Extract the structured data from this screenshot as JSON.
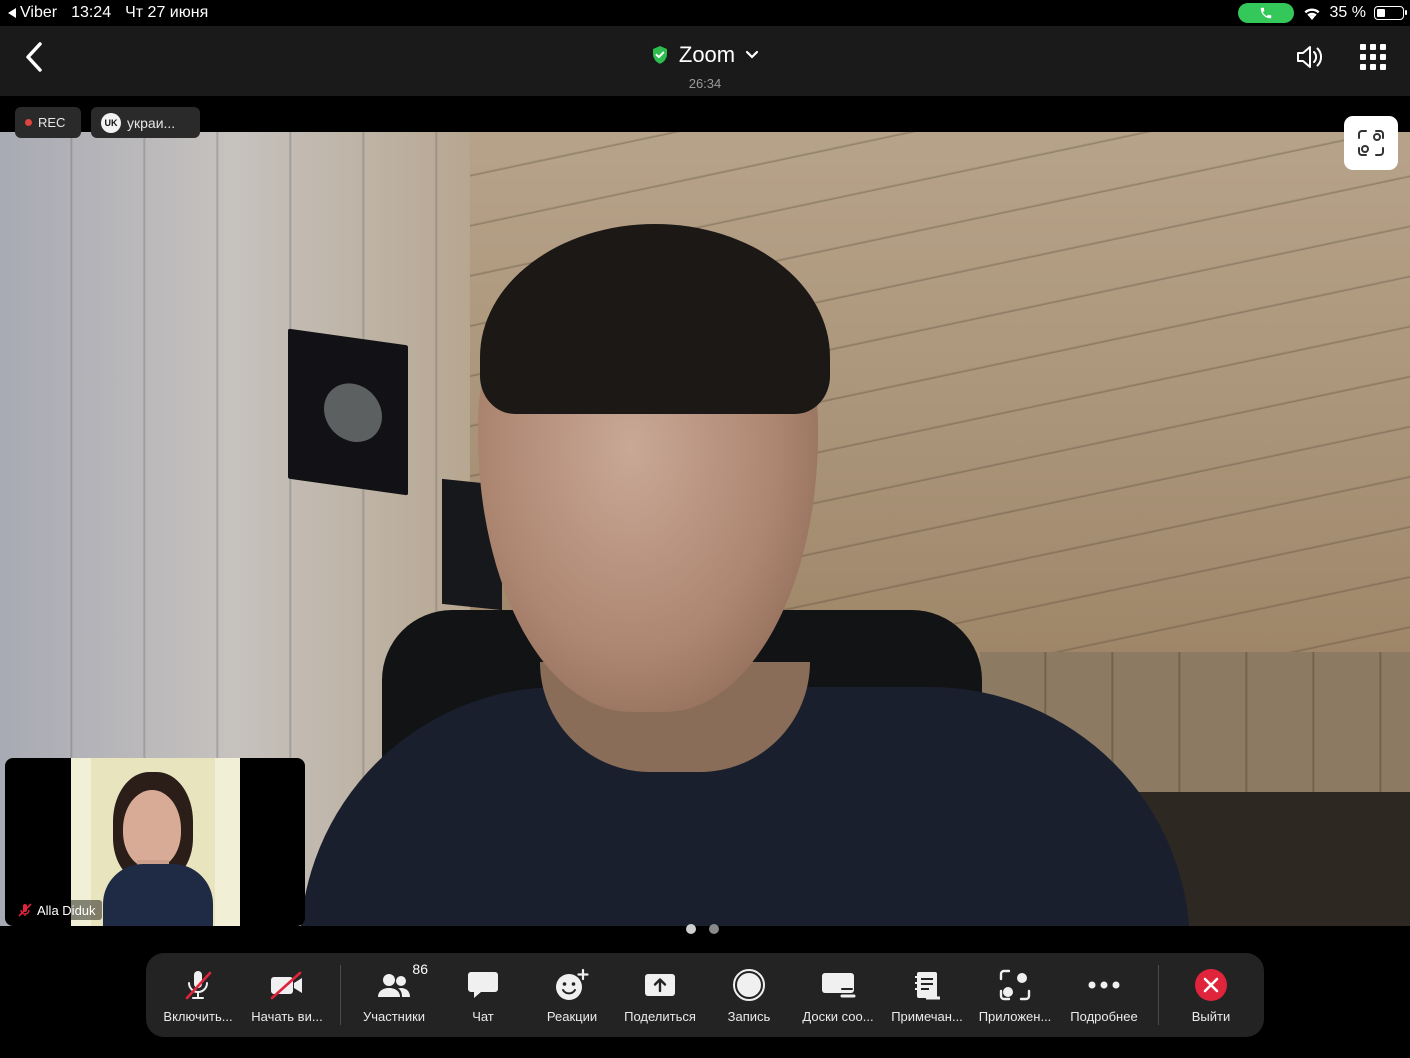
{
  "status_bar": {
    "back_app": "Viber",
    "time": "13:24",
    "date": "Чт 27 июня",
    "battery": "35 %",
    "battery_level": 0.35
  },
  "top_bar": {
    "title": "Zoom",
    "timer": "26:34"
  },
  "chips": {
    "rec": "REC",
    "lang_badge": "UK",
    "lang": "украи..."
  },
  "thumbnail": {
    "name": "Alla Diduk"
  },
  "pagination": {
    "pages": 2,
    "active": 0
  },
  "toolbar": {
    "unmute": "Включить...",
    "video": "Начать ви...",
    "participants": "Участники",
    "participants_count": "86",
    "chat": "Чат",
    "reactions": "Реакции",
    "share": "Поделиться",
    "record": "Запись",
    "whiteboards": "Доски соо...",
    "notes": "Примечан...",
    "apps": "Приложен...",
    "more": "Подробнее",
    "leave": "Выйти"
  },
  "colors": {
    "leave_red": "#e0243b",
    "shield_green": "#2dbd4f",
    "call_green": "#34c759"
  }
}
